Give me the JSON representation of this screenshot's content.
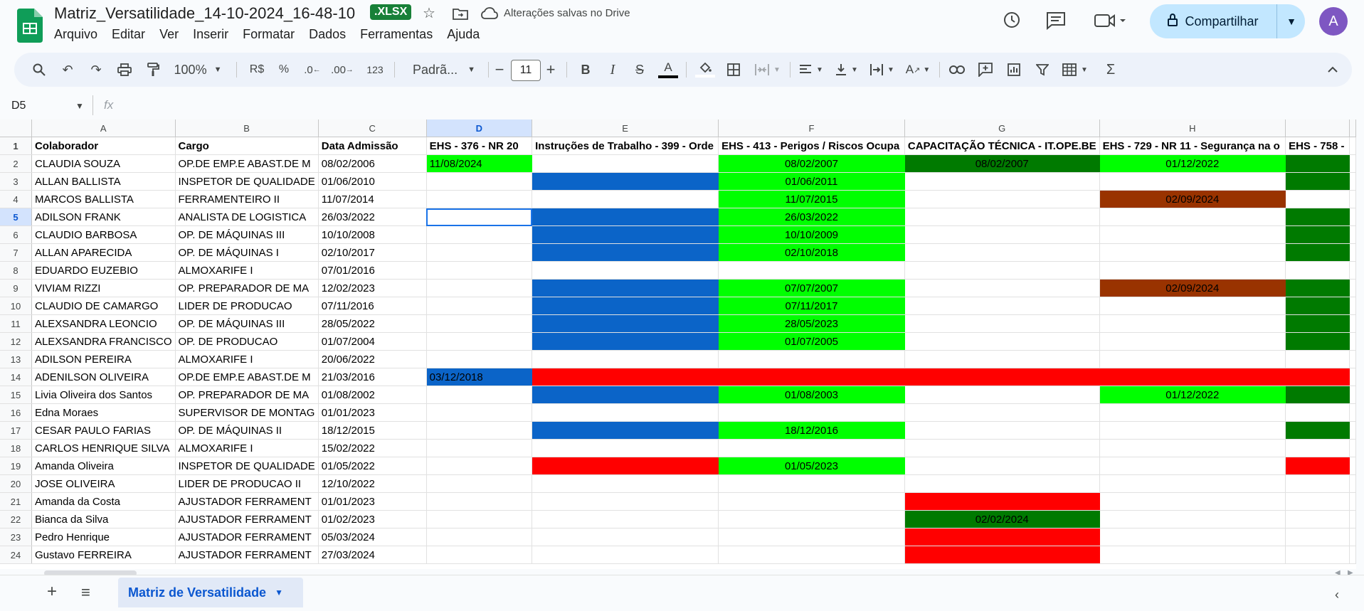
{
  "file": {
    "title": "Matriz_Versatilidade_14-10-2024_16-48-10",
    "badge": ".XLSX",
    "saved_status": "Alterações salvas no Drive"
  },
  "menu": [
    "Arquivo",
    "Editar",
    "Ver",
    "Inserir",
    "Formatar",
    "Dados",
    "Ferramentas",
    "Ajuda"
  ],
  "share": {
    "label": "Compartilhar"
  },
  "user": {
    "avatar_letter": "A"
  },
  "toolbar": {
    "zoom": "100%",
    "currency": "R$",
    "percent": "%",
    "dec_decrease": ".0",
    "dec_increase": ".00",
    "number_format": "123",
    "font": "Padrã...",
    "font_size": "11"
  },
  "formula_bar": {
    "cell_ref": "D5",
    "fx": "fx"
  },
  "colors": {
    "blue": "#0b64c8",
    "green": "#00ff00",
    "dark_green": "#007a00",
    "brown": "#993300",
    "red": "#ff0000",
    "white": "#ffffff"
  },
  "columns": [
    "A",
    "B",
    "C",
    "D",
    "E",
    "F",
    "G",
    "H",
    ""
  ],
  "header": [
    "Colaborador",
    "Cargo",
    "Data Admissão",
    "EHS - 376 - NR 20",
    "Instruções de Trabalho - 399 - Orde",
    "EHS - 413 - Perigos / Riscos Ocupa",
    "CAPACITAÇÃO TÉCNICA - IT.OPE.BE",
    "EHS - 729 - NR 11 - Segurança na o",
    "EHS - 758 -"
  ],
  "rows": [
    {
      "n": "2",
      "c": [
        "CLAUDIA SOUZA",
        "OP.DE EMP.E ABAST.DE M",
        "08/02/2006",
        "11/08/2024",
        "",
        "08/02/2007",
        "08/02/2007",
        "01/12/2022",
        ""
      ],
      "f": [
        "",
        "",
        "",
        "green",
        "",
        "green",
        "dark_green",
        "green",
        "dark_green"
      ]
    },
    {
      "n": "3",
      "c": [
        "ALLAN BALLISTA",
        "INSPETOR DE QUALIDADE",
        "01/06/2010",
        "",
        "",
        "01/06/2011",
        "",
        "",
        ""
      ],
      "f": [
        "",
        "",
        "",
        "",
        "blue",
        "green",
        "",
        "",
        "dark_green"
      ]
    },
    {
      "n": "4",
      "c": [
        "MARCOS BALLISTA",
        "FERRAMENTEIRO II",
        "11/07/2014",
        "",
        "",
        "11/07/2015",
        "",
        "02/09/2024",
        ""
      ],
      "f": [
        "",
        "",
        "",
        "",
        "",
        "green",
        "",
        "brown",
        ""
      ]
    },
    {
      "n": "5",
      "c": [
        "ADILSON FRANK",
        "ANALISTA DE LOGISTICA",
        "26/03/2022",
        "",
        "",
        "26/03/2022",
        "",
        "",
        ""
      ],
      "f": [
        "",
        "",
        "",
        "",
        "blue",
        "green",
        "",
        "",
        "dark_green"
      ]
    },
    {
      "n": "6",
      "c": [
        "CLAUDIO BARBOSA",
        "OP. DE MÁQUINAS III",
        "10/10/2008",
        "",
        "",
        "10/10/2009",
        "",
        "",
        ""
      ],
      "f": [
        "",
        "",
        "",
        "",
        "blue",
        "green",
        "",
        "",
        "dark_green"
      ]
    },
    {
      "n": "7",
      "c": [
        "ALLAN APARECIDA",
        "OP. DE MÁQUINAS I",
        "02/10/2017",
        "",
        "",
        "02/10/2018",
        "",
        "",
        ""
      ],
      "f": [
        "",
        "",
        "",
        "",
        "blue",
        "green",
        "",
        "",
        "dark_green"
      ]
    },
    {
      "n": "8",
      "c": [
        "EDUARDO EUZEBIO",
        "ALMOXARIFE I",
        "07/01/2016",
        "",
        "",
        "",
        "",
        "",
        ""
      ],
      "f": [
        "",
        "",
        "",
        "",
        "",
        "",
        "",
        "",
        ""
      ]
    },
    {
      "n": "9",
      "c": [
        "VIVIAM RIZZI",
        "OP. PREPARADOR DE MA",
        "12/02/2023",
        "",
        "",
        "07/07/2007",
        "",
        "02/09/2024",
        ""
      ],
      "f": [
        "",
        "",
        "",
        "",
        "blue",
        "green",
        "",
        "brown",
        "dark_green"
      ]
    },
    {
      "n": "10",
      "c": [
        "CLAUDIO DE CAMARGO",
        "LIDER DE PRODUCAO",
        "07/11/2016",
        "",
        "",
        "07/11/2017",
        "",
        "",
        ""
      ],
      "f": [
        "",
        "",
        "",
        "",
        "blue",
        "green",
        "",
        "",
        "dark_green"
      ]
    },
    {
      "n": "11",
      "c": [
        "ALEXSANDRA LEONCIO",
        "OP. DE MÁQUINAS III",
        "28/05/2022",
        "",
        "",
        "28/05/2023",
        "",
        "",
        ""
      ],
      "f": [
        "",
        "",
        "",
        "",
        "blue",
        "green",
        "",
        "",
        "dark_green"
      ]
    },
    {
      "n": "12",
      "c": [
        "ALEXSANDRA FRANCISCO",
        "OP. DE PRODUCAO",
        "01/07/2004",
        "",
        "",
        "01/07/2005",
        "",
        "",
        ""
      ],
      "f": [
        "",
        "",
        "",
        "",
        "blue",
        "green",
        "",
        "",
        "dark_green"
      ]
    },
    {
      "n": "13",
      "c": [
        "ADILSON PEREIRA",
        "ALMOXARIFE I",
        "20/06/2022",
        "",
        "",
        "",
        "",
        "",
        ""
      ],
      "f": [
        "",
        "",
        "",
        "",
        "",
        "",
        "",
        "",
        ""
      ]
    },
    {
      "n": "14",
      "c": [
        "ADENILSON OLIVEIRA",
        "OP.DE EMP.E ABAST.DE M",
        "21/03/2016",
        "03/12/2018",
        "",
        "",
        "",
        "",
        ""
      ],
      "f": [
        "",
        "",
        "",
        "blue",
        "red",
        "red",
        "red",
        "red",
        "red"
      ]
    },
    {
      "n": "15",
      "c": [
        "Livia Oliveira dos Santos",
        "OP. PREPARADOR DE MA",
        "01/08/2002",
        "",
        "",
        "01/08/2003",
        "",
        "01/12/2022",
        ""
      ],
      "f": [
        "",
        "",
        "",
        "",
        "blue",
        "green",
        "",
        "green",
        "dark_green"
      ]
    },
    {
      "n": "16",
      "c": [
        "Edna Moraes",
        "SUPERVISOR DE MONTAG",
        "01/01/2023",
        "",
        "",
        "",
        "",
        "",
        ""
      ],
      "f": [
        "",
        "",
        "",
        "",
        "",
        "",
        "",
        "",
        ""
      ]
    },
    {
      "n": "17",
      "c": [
        "CESAR PAULO FARIAS",
        "OP. DE MÁQUINAS II",
        "18/12/2015",
        "",
        "",
        "18/12/2016",
        "",
        "",
        ""
      ],
      "f": [
        "",
        "",
        "",
        "",
        "blue",
        "green",
        "",
        "",
        "dark_green"
      ]
    },
    {
      "n": "18",
      "c": [
        "CARLOS HENRIQUE SILVA",
        "ALMOXARIFE I",
        "15/02/2022",
        "",
        "",
        "",
        "",
        "",
        ""
      ],
      "f": [
        "",
        "",
        "",
        "",
        "",
        "",
        "",
        "",
        ""
      ]
    },
    {
      "n": "19",
      "c": [
        "Amanda Oliveira",
        "INSPETOR DE QUALIDADE",
        "01/05/2022",
        "",
        "",
        "01/05/2023",
        "",
        "",
        ""
      ],
      "f": [
        "",
        "",
        "",
        "",
        "red",
        "green",
        "",
        "",
        "red"
      ]
    },
    {
      "n": "20",
      "c": [
        "JOSE OLIVEIRA",
        "LIDER DE PRODUCAO II",
        "12/10/2022",
        "",
        "",
        "",
        "",
        "",
        ""
      ],
      "f": [
        "",
        "",
        "",
        "",
        "",
        "",
        "",
        "",
        ""
      ]
    },
    {
      "n": "21",
      "c": [
        "Amanda da Costa",
        "AJUSTADOR FERRAMENT",
        "01/01/2023",
        "",
        "",
        "",
        "",
        "",
        ""
      ],
      "f": [
        "",
        "",
        "",
        "",
        "",
        "",
        "red",
        "",
        ""
      ]
    },
    {
      "n": "22",
      "c": [
        "Bianca da Silva",
        "AJUSTADOR FERRAMENT",
        "01/02/2023",
        "",
        "",
        "",
        "02/02/2024",
        "",
        ""
      ],
      "f": [
        "",
        "",
        "",
        "",
        "",
        "",
        "dark_green",
        "",
        ""
      ]
    },
    {
      "n": "23",
      "c": [
        "Pedro Henrique",
        "AJUSTADOR FERRAMENT",
        "05/03/2024",
        "",
        "",
        "",
        "",
        "",
        ""
      ],
      "f": [
        "",
        "",
        "",
        "",
        "",
        "",
        "red",
        "",
        ""
      ]
    },
    {
      "n": "24",
      "c": [
        "Gustavo FERREIRA",
        "AJUSTADOR FERRAMENT",
        "27/03/2024",
        "",
        "",
        "",
        "",
        "",
        ""
      ],
      "f": [
        "",
        "",
        "",
        "",
        "",
        "",
        "red",
        "",
        ""
      ]
    }
  ],
  "sheets": [
    {
      "label": "Matriz de Versatilidade"
    }
  ]
}
